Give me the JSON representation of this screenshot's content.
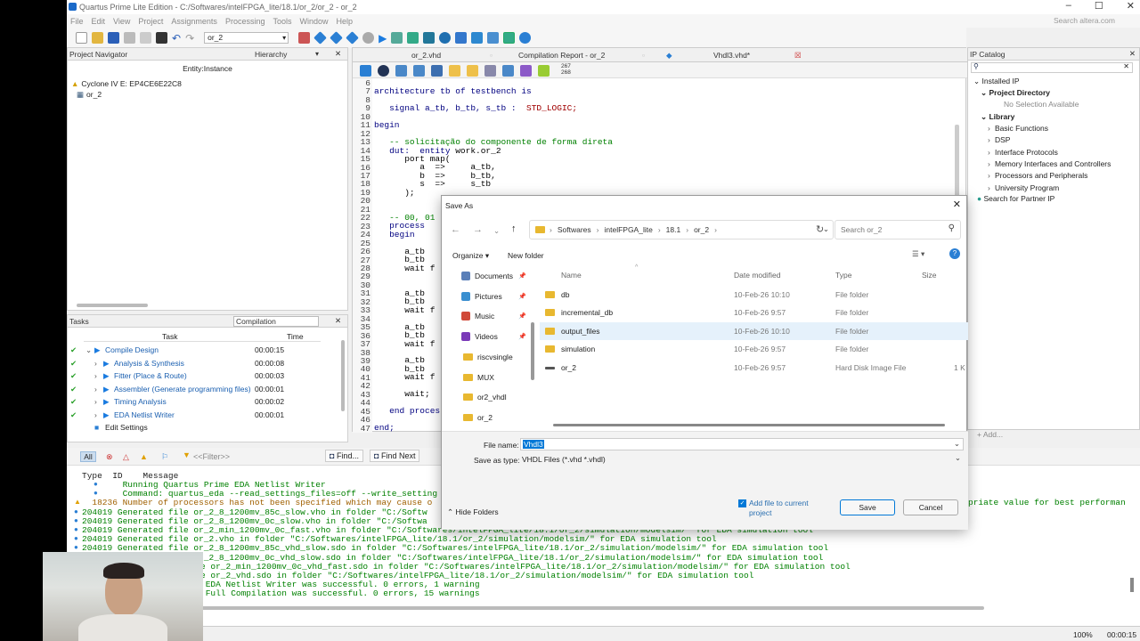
{
  "window": {
    "title": "Quartus Prime Lite Edition - C:/Softwares/intelFPGA_lite/18.1/or_2/or_2 - or_2",
    "search": "Search altera.com"
  },
  "menu": [
    "File",
    "Edit",
    "View",
    "Project",
    "Assignments",
    "Processing",
    "Tools",
    "Window",
    "Help"
  ],
  "toolbar": {
    "entity_select": "or_2"
  },
  "navigator": {
    "title": "Project Navigator",
    "view": "Hierarchy",
    "col": "Entity:Instance",
    "device": "Cyclone IV E: EP4CE6E22C8",
    "top": "or_2"
  },
  "tasks": {
    "title": "Tasks",
    "flow": "Compilation",
    "col_task": "Task",
    "col_time": "Time",
    "rows": [
      {
        "label": "Compile Design",
        "time": "00:00:15"
      },
      {
        "label": "Analysis & Synthesis",
        "time": "00:00:08"
      },
      {
        "label": "Fitter (Place & Route)",
        "time": "00:00:03"
      },
      {
        "label": "Assembler (Generate programming files)",
        "time": "00:00:01"
      },
      {
        "label": "Timing Analysis",
        "time": "00:00:02"
      },
      {
        "label": "EDA Netlist Writer",
        "time": "00:00:01"
      },
      {
        "label": "Edit Settings",
        "time": ""
      }
    ]
  },
  "editor": {
    "tabs": [
      "or_2.vhd",
      "Compilation Report - or_2",
      "Vhdl3.vhd*"
    ],
    "counter": "267\n268",
    "line_numbers": [
      "6",
      "7",
      "8",
      "9",
      "10",
      "11",
      "12",
      "13",
      "14",
      "15",
      "16",
      "17",
      "18",
      "19",
      "20",
      "21",
      "22",
      "23",
      "24",
      "25",
      "26",
      "27",
      "28",
      "29",
      "30",
      "31",
      "32",
      "33",
      "34",
      "35",
      "36",
      "37",
      "38",
      "39",
      "40",
      "41",
      "42",
      "43",
      "44",
      "45",
      "46",
      "47"
    ],
    "code": {
      "l7": "architecture tb of testbench is",
      "l9a": "   signal a_tb, b_tb, s_tb :  ",
      "l9b": "STD_LOGIC;",
      "l11": "begin",
      "l13": "   -- solicitação do componente de forma direta",
      "l14a": "   dut:  entity ",
      "l14b": "work.or_2",
      "l15": "      port map(",
      "l16": "         a  =>     a_tb,",
      "l17": "         b  =>     b_tb,",
      "l18": "         s  =>     s_tb",
      "l19": "      );",
      "l22": "   -- 00, 01",
      "l23": "   process",
      "l24": "   begin",
      "l26": "      a_tb",
      "l27": "      b_tb",
      "l28": "      wait f",
      "l31": "      a_tb",
      "l32": "      b_tb",
      "l33": "      wait f",
      "l35": "      a_tb",
      "l36": "      b_tb",
      "l37": "      wait f",
      "l39": "      a_tb",
      "l40": "      b_tb",
      "l41": "      wait f",
      "l43": "      wait;",
      "l45": "   end proces",
      "l47": "end;"
    }
  },
  "ip": {
    "title": "IP Catalog",
    "installed": "Installed IP",
    "projdir": "Project Directory",
    "nosel": "No Selection Available",
    "library": "Library",
    "items": [
      "Basic Functions",
      "DSP",
      "Interface Protocols",
      "Memory Interfaces and Controllers",
      "Processors and Peripherals",
      "University Program"
    ],
    "partner": "Search for Partner IP",
    "add": "+ Add..."
  },
  "dialog": {
    "title": "Save As",
    "breadcrumb": [
      "Softwares",
      "intelFPGA_lite",
      "18.1",
      "or_2"
    ],
    "search_placeholder": "Search or_2",
    "organize": "Organize ▾",
    "new_folder": "New folder",
    "sidebar": [
      "Documents",
      "Pictures",
      "Music",
      "Videos",
      "riscvsingle",
      "MUX",
      "or2_vhdl",
      "or_2"
    ],
    "cols": {
      "name": "Name",
      "date": "Date modified",
      "type": "Type",
      "size": "Size"
    },
    "files": [
      {
        "name": "db",
        "date": "10-Feb-26 10:10",
        "type": "File folder",
        "size": ""
      },
      {
        "name": "incremental_db",
        "date": "10-Feb-26 9:57",
        "type": "File folder",
        "size": ""
      },
      {
        "name": "output_files",
        "date": "10-Feb-26 10:10",
        "type": "File folder",
        "size": ""
      },
      {
        "name": "simulation",
        "date": "10-Feb-26 9:57",
        "type": "File folder",
        "size": ""
      },
      {
        "name": "or_2",
        "date": "10-Feb-26 9:57",
        "type": "Hard Disk Image File",
        "size": "1 K"
      }
    ],
    "filename_label": "File name:",
    "filename": "Vhdl3",
    "type_label": "Save as type:",
    "type": "VHDL Files (*.vhd *.vhdl)",
    "hide": "Hide Folders",
    "addfile": "Add file to current project",
    "save": "Save",
    "cancel": "Cancel"
  },
  "messages": {
    "all": "All",
    "filter": "<<Filter>>",
    "find": "Find...",
    "findnext": "Find Next",
    "hdr": "Type  ID    Message",
    "lines": [
      "        Running Quartus Prime EDA Netlist Writer",
      "        Command: quartus_eda --read_settings_files=off --write_setting",
      "  18236 Number of processors has not been specified which may cause o",
      "204019 Generated file or_2_8_1200mv_85c_slow.vho in folder \"C:/Softw",
      "204019 Generated file or_2_8_1200mv_0c_slow.vho in folder \"C:/Softwa",
      "204019 Generated file or_2_min_1200mv_0c_fast.vho in folder \"C:/Softwares/intelFPGA_lite/18.1/or_2/simulation/modelsim/\" for EDA simulation tool",
      "204019 Generated file or_2.vho in folder \"C:/Softwares/intelFPGA_lite/18.1/or_2/simulation/modelsim/\" for EDA simulation tool",
      "204019 Generated file or_2_8_1200mv_85c_vhd_slow.sdo in folder \"C:/Softwares/intelFPGA_lite/18.1/or_2/simulation/modelsim/\" for EDA simulation tool",
      "204019 Generated file or_2_8_1200mv_0c_vhd_slow.sdo in folder \"C:/Softwares/intelFPGA_lite/18.1/or_2/simulation/modelsim/\" for EDA simulation tool",
      "e or_2_min_1200mv_0c_vhd_fast.sdo in folder \"C:/Softwares/intelFPGA_lite/18.1/or_2/simulation/modelsim/\" for EDA simulation tool",
      "e or_2_vhd.sdo in folder \"C:/Softwares/intelFPGA_lite/18.1/or_2/simulation/modelsim/\" for EDA simulation tool",
      " EDA Netlist Writer was successful. 0 errors, 1 warning",
      " Full Compilation was successful. 0 errors, 15 warnings"
    ],
    "right_tail": "priate value for best performan"
  },
  "status": {
    "zoom": "100%",
    "time": "00:00:15"
  }
}
